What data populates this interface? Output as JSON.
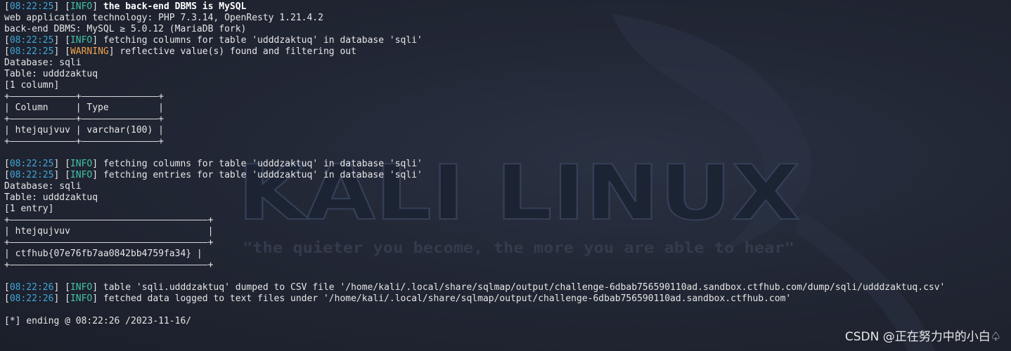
{
  "wallpaper": {
    "logo_text": "KALI LINUX",
    "tagline": "\"the quieter you become, the more you are able to hear\""
  },
  "terminal": {
    "lines": [
      [
        {
          "t": "[",
          "c": "text"
        },
        {
          "t": "08:22:25",
          "c": "ts"
        },
        {
          "t": "] [",
          "c": "text"
        },
        {
          "t": "INFO",
          "c": "info"
        },
        {
          "t": "] ",
          "c": "text"
        },
        {
          "t": "the back-end DBMS is MySQL",
          "c": "bold"
        }
      ],
      [
        {
          "t": "web application technology: PHP 7.3.14, OpenResty 1.21.4.2",
          "c": "text"
        }
      ],
      [
        {
          "t": "back-end DBMS: MySQL ≥ 5.0.12 (MariaDB fork)",
          "c": "text"
        }
      ],
      [
        {
          "t": "[",
          "c": "text"
        },
        {
          "t": "08:22:25",
          "c": "ts"
        },
        {
          "t": "] [",
          "c": "text"
        },
        {
          "t": "INFO",
          "c": "info"
        },
        {
          "t": "] fetching columns for table 'udddzaktuq' in database 'sqli'",
          "c": "text"
        }
      ],
      [
        {
          "t": "[",
          "c": "text"
        },
        {
          "t": "08:22:25",
          "c": "ts"
        },
        {
          "t": "] [",
          "c": "text"
        },
        {
          "t": "WARNING",
          "c": "warn"
        },
        {
          "t": "] reflective value(s) found and filtering out",
          "c": "text"
        }
      ],
      [
        {
          "t": "Database: sqli",
          "c": "text"
        }
      ],
      [
        {
          "t": "Table: udddzaktuq",
          "c": "text"
        }
      ],
      [
        {
          "t": "[1 column]",
          "c": "text"
        }
      ],
      [
        {
          "t": "+————————————+——————————————+",
          "c": "text"
        }
      ],
      [
        {
          "t": "| Column     | Type         |",
          "c": "text"
        }
      ],
      [
        {
          "t": "+————————————+——————————————+",
          "c": "text"
        }
      ],
      [
        {
          "t": "| htejqujvuv | varchar(100) |",
          "c": "text"
        }
      ],
      [
        {
          "t": "+————————————+——————————————+",
          "c": "text"
        }
      ],
      [
        {
          "t": "",
          "c": "text"
        }
      ],
      [
        {
          "t": "[",
          "c": "text"
        },
        {
          "t": "08:22:25",
          "c": "ts"
        },
        {
          "t": "] [",
          "c": "text"
        },
        {
          "t": "INFO",
          "c": "info"
        },
        {
          "t": "] fetching columns for table 'udddzaktuq' in database 'sqli'",
          "c": "text"
        }
      ],
      [
        {
          "t": "[",
          "c": "text"
        },
        {
          "t": "08:22:25",
          "c": "ts"
        },
        {
          "t": "] [",
          "c": "text"
        },
        {
          "t": "INFO",
          "c": "info"
        },
        {
          "t": "] fetching entries for table 'udddzaktuq' in database 'sqli'",
          "c": "text"
        }
      ],
      [
        {
          "t": "Database: sqli",
          "c": "text"
        }
      ],
      [
        {
          "t": "Table: udddzaktuq",
          "c": "text"
        }
      ],
      [
        {
          "t": "[1 entry]",
          "c": "text"
        }
      ],
      [
        {
          "t": "+————————————————————————————————————+",
          "c": "text"
        }
      ],
      [
        {
          "t": "| htejqujvuv                         |",
          "c": "text"
        }
      ],
      [
        {
          "t": "+————————————————————————————————————+",
          "c": "text"
        }
      ],
      [
        {
          "t": "| ctfhub{07e76fb7aa0842bb4759fa34} |",
          "c": "text"
        }
      ],
      [
        {
          "t": "+————————————————————————————————————+",
          "c": "text"
        }
      ],
      [
        {
          "t": "",
          "c": "text"
        }
      ],
      [
        {
          "t": "[",
          "c": "text"
        },
        {
          "t": "08:22:26",
          "c": "ts"
        },
        {
          "t": "] [",
          "c": "text"
        },
        {
          "t": "INFO",
          "c": "info"
        },
        {
          "t": "] table 'sqli.udddzaktuq' dumped to CSV file '/home/kali/.local/share/sqlmap/output/challenge-6dbab756590110ad.sandbox.ctfhub.com/dump/sqli/udddzaktuq.csv'",
          "c": "text"
        }
      ],
      [
        {
          "t": "[",
          "c": "text"
        },
        {
          "t": "08:22:26",
          "c": "ts"
        },
        {
          "t": "] [",
          "c": "text"
        },
        {
          "t": "INFO",
          "c": "info"
        },
        {
          "t": "] fetched data logged to text files under '/home/kali/.local/share/sqlmap/output/challenge-6dbab756590110ad.sandbox.ctfhub.com'",
          "c": "text"
        }
      ],
      [
        {
          "t": "",
          "c": "text"
        }
      ],
      [
        {
          "t": "[*] ending @ 08:22:26 /2023-11-16/",
          "c": "text"
        }
      ]
    ]
  },
  "watermark": {
    "text": "CSDN @正在努力中的小白♤"
  }
}
